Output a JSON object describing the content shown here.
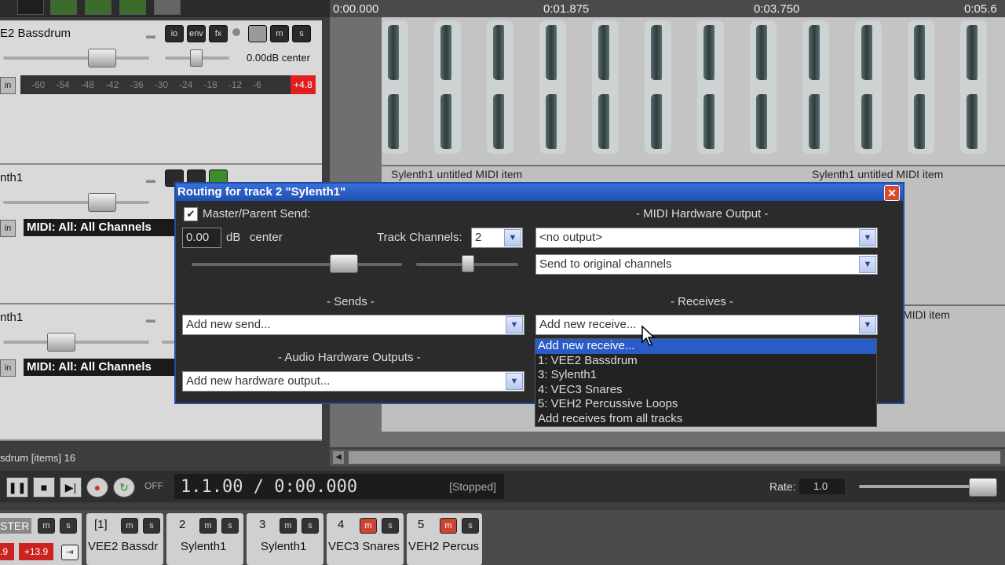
{
  "ruler": {
    "t0": "0:00.000",
    "t1": "0:01.875",
    "t2": "0:03.750",
    "t3": "0:05.6"
  },
  "tracks": [
    {
      "name": "E2 Bassdrum",
      "vol": "0.00dB center",
      "meter_labels": [
        "-60",
        "-54",
        "-48",
        "-42",
        "-36",
        "-30",
        "-24",
        "-18",
        "-12",
        "-6"
      ],
      "peak": "+4.8",
      "btns": [
        "io",
        "env",
        "fx",
        "m",
        "s"
      ]
    },
    {
      "name": "nth1",
      "midi_input": "MIDI: All: All Channels"
    },
    {
      "name": "nth1",
      "midi_input": "MIDI: All: All Channels"
    }
  ],
  "in_label": "in",
  "items": {
    "label1": "Sylenth1 untitled MIDI item",
    "label2": "Sylenth1 untitled MIDI item",
    "label3": "MIDI item"
  },
  "status_line": "sdrum [items] 16",
  "transport": {
    "off": "OFF",
    "time": "1.1.00 / 0:00.000",
    "state": "[Stopped]",
    "rate_label": "Rate:",
    "rate_value": "1.0"
  },
  "mixer": {
    "master": {
      "label": "STER",
      "m": "m",
      "s": "s",
      "vals": [
        ".9",
        "+13.9"
      ]
    },
    "strips": [
      {
        "num": "[1]",
        "name": "VEE2 Bassdr"
      },
      {
        "num": "2",
        "name": "Sylenth1"
      },
      {
        "num": "3",
        "name": "Sylenth1"
      },
      {
        "num": "4",
        "name": "VEC3 Snares"
      },
      {
        "num": "5",
        "name": "VEH2 Percus"
      }
    ]
  },
  "dialog": {
    "title": "Routing for track 2 \"Sylenth1\"",
    "master_send": "Master/Parent Send:",
    "db_value": "0.00",
    "db_label": "dB",
    "pan": "center",
    "track_channels_label": "Track Channels:",
    "track_channels_value": "2",
    "midi_hw_title": "- MIDI Hardware Output -",
    "midi_output": "<no output>",
    "midi_channels": "Send to original channels",
    "sends_title": "- Sends -",
    "receives_title": "- Receives -",
    "add_send": "Add new send...",
    "add_receive": "Add new receive...",
    "audio_hw_title": "- Audio Hardware Outputs -",
    "add_hw_output": "Add new hardware output...",
    "receive_options": [
      "Add new receive...",
      "1: VEE2 Bassdrum",
      "3: Sylenth1",
      "4: VEC3 Snares",
      "5: VEH2 Percussive Loops",
      "Add receives from all tracks"
    ]
  }
}
